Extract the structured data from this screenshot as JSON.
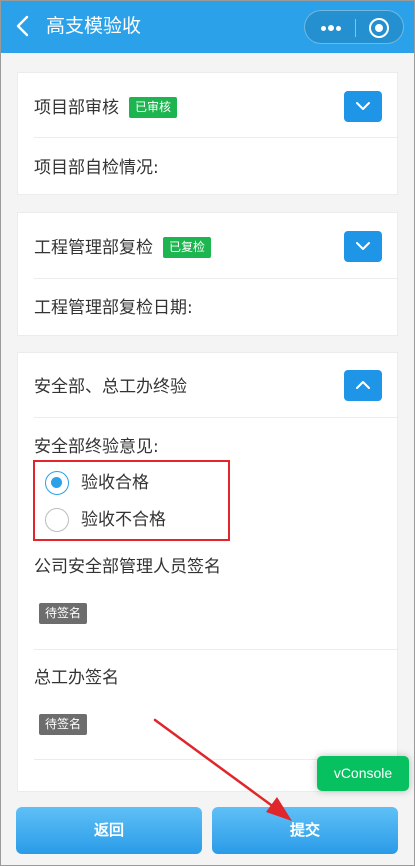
{
  "navbar": {
    "title": "高支模验收",
    "more_icon": "more-dots-icon",
    "close_icon": "target-close-icon"
  },
  "card1": {
    "title": "项目部审核",
    "badge": "已审核",
    "field_label": "项目部自检情况:",
    "expanded": false
  },
  "card2": {
    "title": "工程管理部复检",
    "badge": "已复检",
    "field_label": "工程管理部复检日期:",
    "expanded": false
  },
  "card3": {
    "title": "安全部、总工办终验",
    "expanded": true,
    "opinion_label": "安全部终验意见:",
    "options": [
      {
        "label": "验收合格",
        "checked": true
      },
      {
        "label": "验收不合格",
        "checked": false
      }
    ],
    "safety_sign_label": "公司安全部管理人员签名",
    "safety_sign_status": "待签名",
    "chief_sign_label": "总工办签名",
    "chief_sign_status": "待签名"
  },
  "vconsole": "vConsole",
  "footer": {
    "back_label": "返回",
    "submit_label": "提交"
  },
  "colors": {
    "primary": "#2aa1e8",
    "badge_green": "#1db54f",
    "highlight_red": "#e0262b",
    "vconsole_green": "#07c160"
  }
}
